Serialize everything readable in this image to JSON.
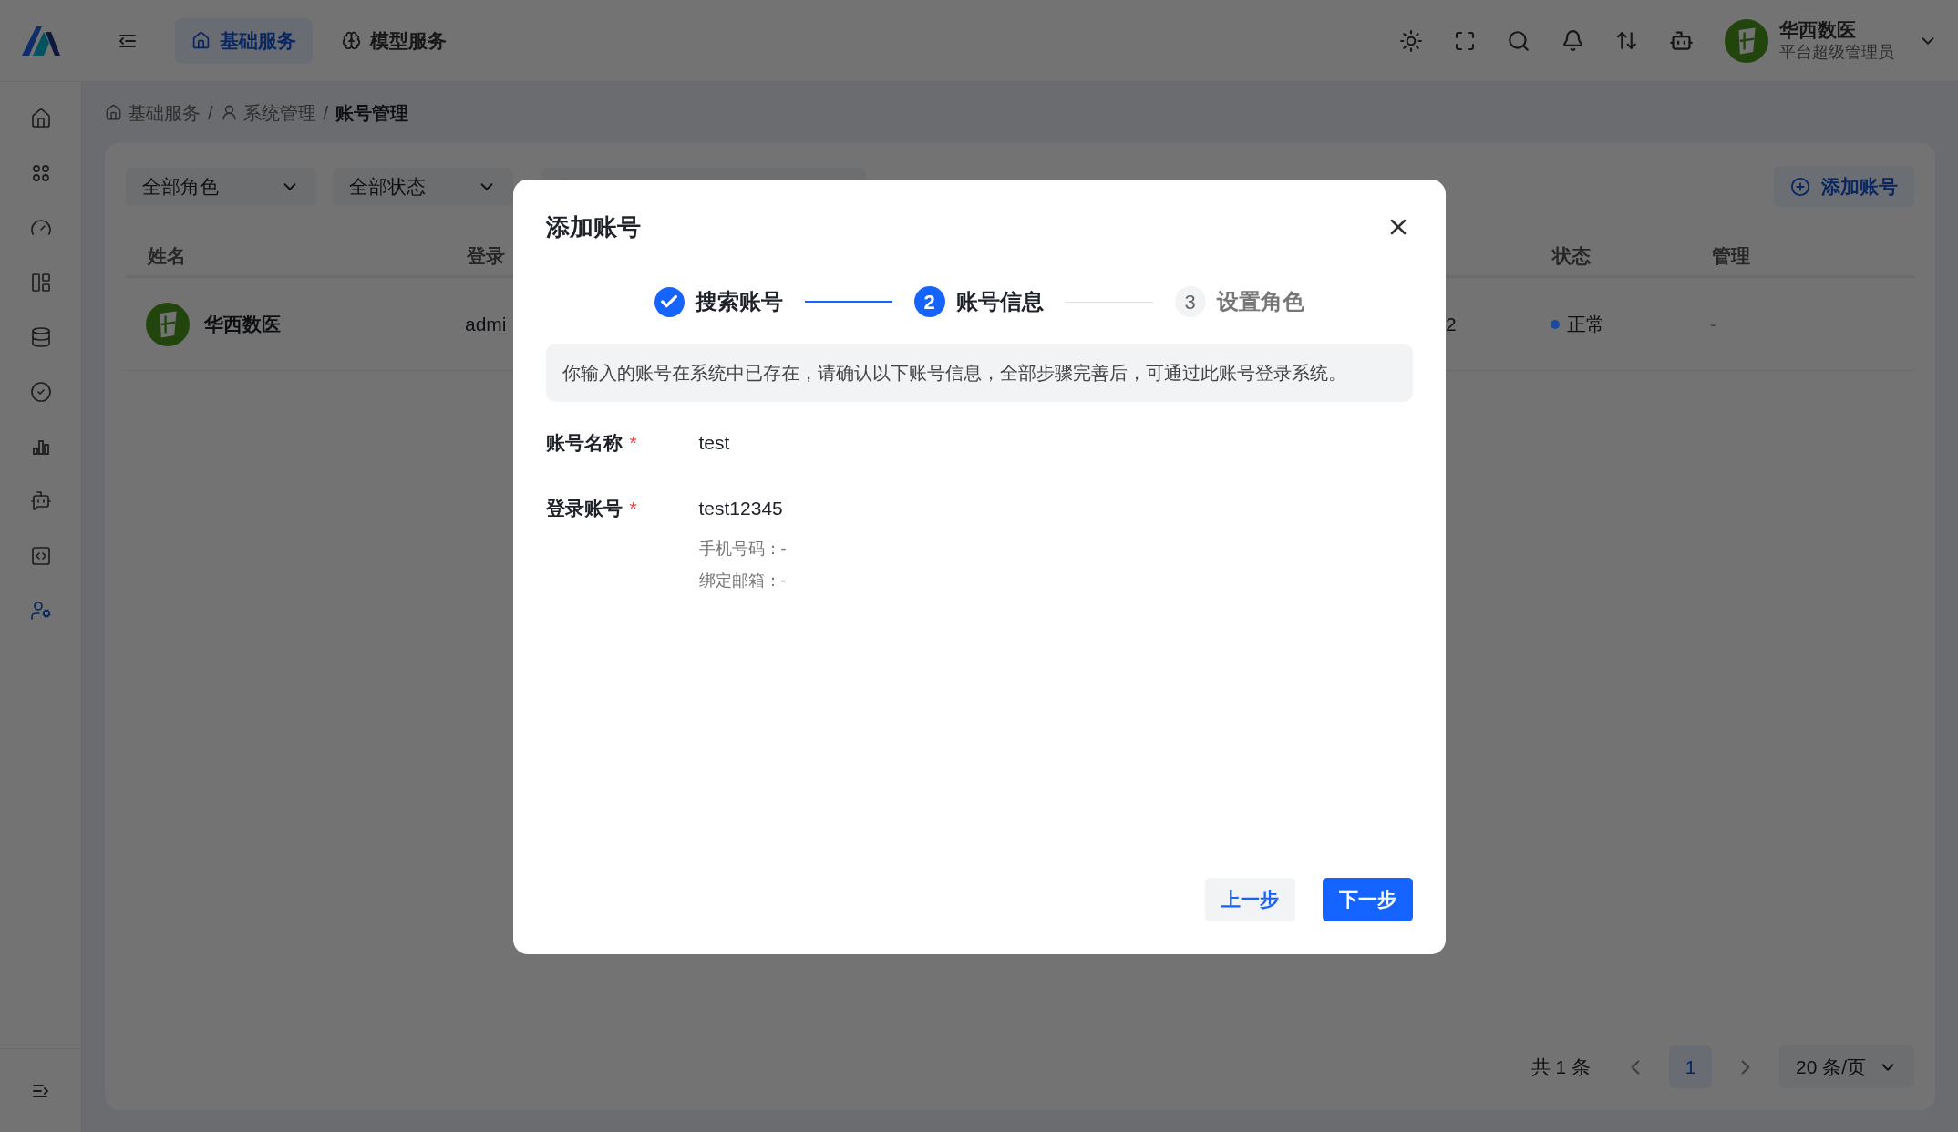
{
  "top_bar": {
    "nav_tabs": [
      {
        "label": "基础服务",
        "kind": "home",
        "selected": true
      },
      {
        "label": "模型服务",
        "kind": "brain",
        "selected": false
      }
    ],
    "user": {
      "name": "华西数医",
      "role": "平台超级管理员"
    }
  },
  "sidebar": {
    "items": [
      {
        "kind": "home",
        "selected": false
      },
      {
        "kind": "apps",
        "selected": false
      },
      {
        "kind": "gauge",
        "selected": false
      },
      {
        "kind": "layout",
        "selected": false
      },
      {
        "kind": "database",
        "selected": false
      },
      {
        "kind": "check",
        "selected": false
      },
      {
        "kind": "chart",
        "selected": false
      },
      {
        "kind": "bot",
        "selected": false
      },
      {
        "kind": "code",
        "selected": false
      },
      {
        "kind": "user",
        "selected": true
      }
    ]
  },
  "breadcrumb": {
    "separator": "/",
    "items": [
      {
        "label": "基础服务",
        "kind": "home",
        "current": false
      },
      {
        "label": "系统管理",
        "kind": "user",
        "current": false
      },
      {
        "label": "账号管理",
        "current": true
      }
    ]
  },
  "filters": [
    {
      "value": "全部角色"
    },
    {
      "value": "全部状态"
    }
  ],
  "add_button": "添加账号",
  "table": {
    "headers": {
      "name": "姓名",
      "login": "登录",
      "status": "状态",
      "manage": "管理"
    },
    "rows": [
      {
        "name": "华西数医",
        "login": "admi",
        "column_3": "2",
        "status": "正常",
        "color": "#1e4a9e",
        "manage": "-"
      }
    ]
  },
  "pagination": {
    "total": "共 1 条",
    "pages": [
      {
        "label": "1",
        "selected": true
      }
    ],
    "page_size": "20 条/页"
  },
  "modal": {
    "title": "添加账号",
    "required_mark": "*",
    "steps": [
      {
        "label": "搜索账号",
        "kind": "done"
      },
      {
        "number": "2",
        "label": "账号信息",
        "kind": "current"
      },
      {
        "number": "3",
        "label": "设置角色",
        "kind": "pending"
      }
    ],
    "notice": "你输入的账号在系统中已存在，请确认以下账号信息，全部步骤完善后，可通过此账号登录系统。",
    "fields": [
      {
        "label": "账号名称",
        "required": true,
        "value": "test"
      },
      {
        "label": "登录账号",
        "required": true,
        "value": "test12345",
        "details": [
          "手机号码：-",
          "绑定邮箱：-"
        ]
      }
    ],
    "buttons": [
      {
        "label": "上一步",
        "kind": "secondary"
      },
      {
        "label": "下一步",
        "kind": "primary"
      }
    ]
  }
}
